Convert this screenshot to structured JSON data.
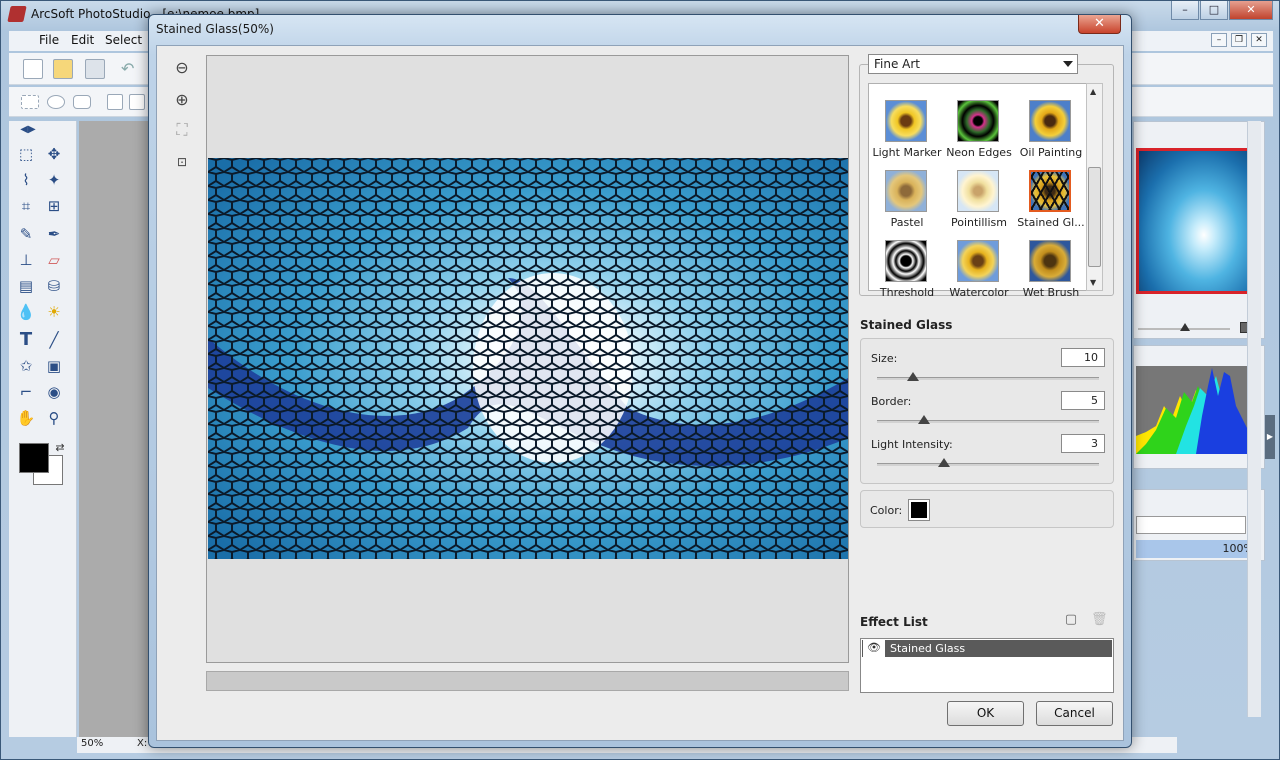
{
  "app": {
    "title": "ArcSoft PhotoStudio - [e:\\nemoe.bmp]",
    "menu": [
      "File",
      "Edit",
      "Select"
    ],
    "status": {
      "zoom": "50%",
      "coord_label": "X:"
    },
    "window_buttons": {
      "minimize": "–",
      "maximize": "□",
      "close": "✕"
    },
    "nav_zoom": "100%"
  },
  "dialog": {
    "title": "Stained Glass(50%)",
    "close_label": "✕",
    "category": "Fine Art",
    "effects": [
      {
        "label": "Light Marker",
        "selected": false
      },
      {
        "label": "Neon Edges",
        "selected": false
      },
      {
        "label": "Oil Painting",
        "selected": false
      },
      {
        "label": "Pastel",
        "selected": false
      },
      {
        "label": "Pointillism",
        "selected": false
      },
      {
        "label": "Stained Gl...",
        "selected": true
      },
      {
        "label": "Threshold",
        "selected": false
      },
      {
        "label": "Watercolor",
        "selected": false
      },
      {
        "label": "Wet Brush",
        "selected": false
      }
    ],
    "section_title": "Stained Glass",
    "params": [
      {
        "label": "Size:",
        "value": "10",
        "level": 0.16
      },
      {
        "label": "Border:",
        "value": "5",
        "level": 0.21
      },
      {
        "label": "Light Intensity:",
        "value": "3",
        "level": 0.3
      }
    ],
    "color_label": "Color:",
    "color_value": "#000000",
    "effect_list_title": "Effect List",
    "effect_list_items": [
      "Stained Glass"
    ],
    "ok_label": "OK",
    "cancel_label": "Cancel"
  },
  "colors": {
    "accent_selected": "#e45b1f",
    "title_close": "#c8432c",
    "list_row": "#5a5a5a"
  }
}
